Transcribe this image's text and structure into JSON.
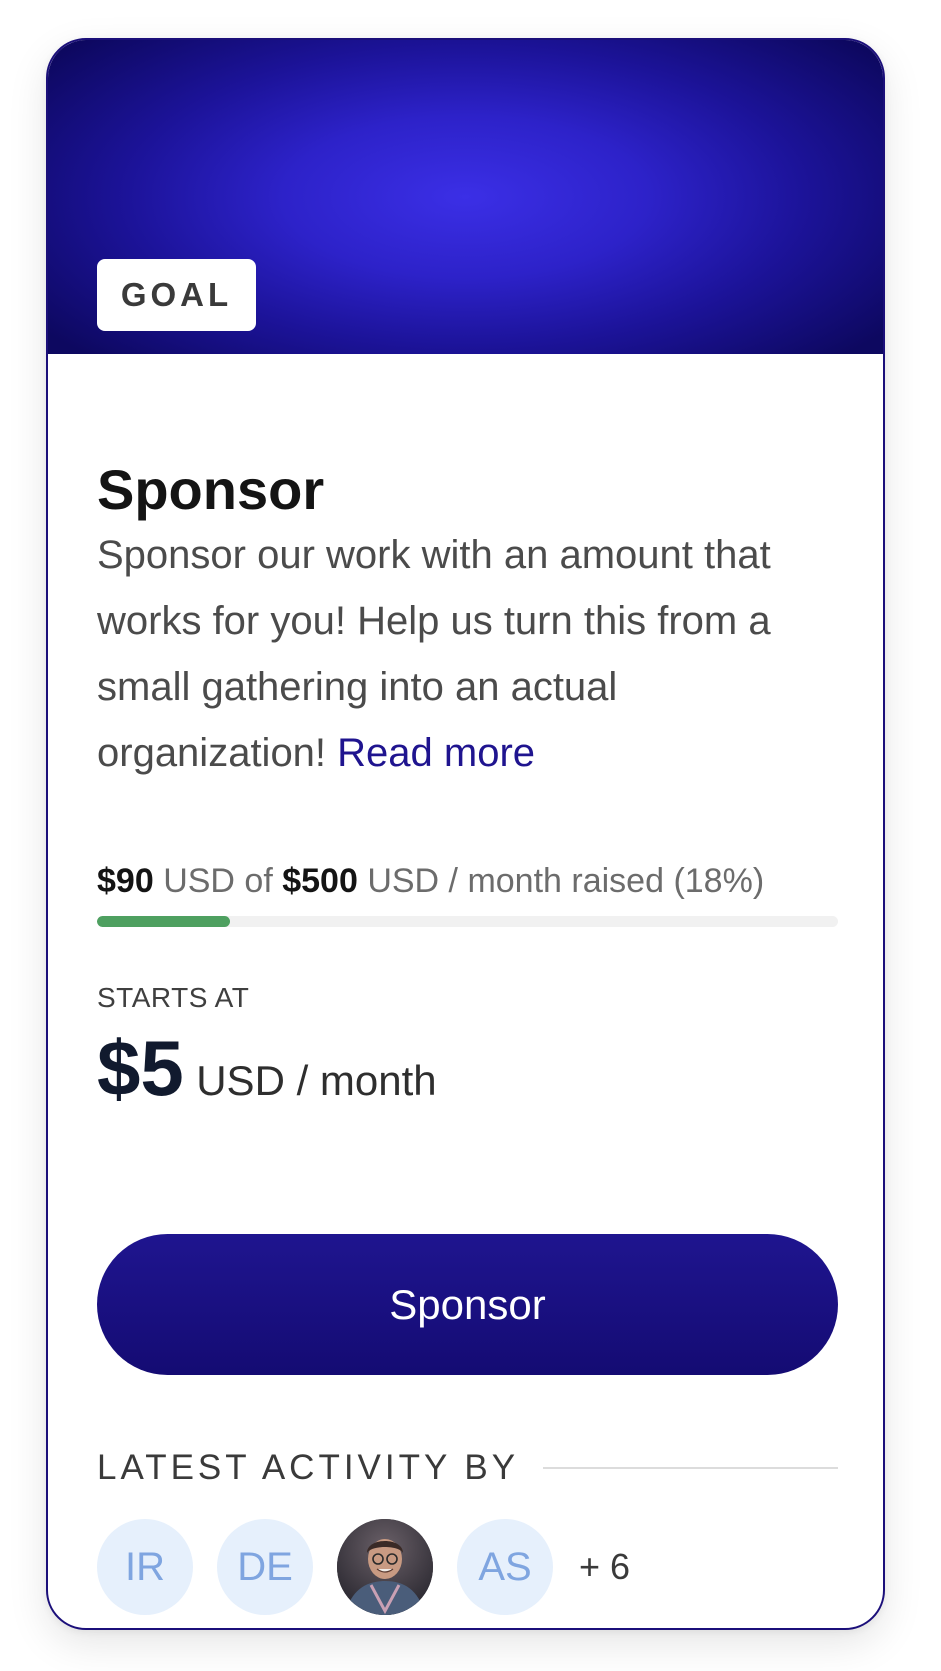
{
  "tier": {
    "badge": "GOAL",
    "title": "Sponsor",
    "description": "Sponsor our work with an amount that works for you! Help us turn this from a small gathering into an actual organization!",
    "read_more": "Read more"
  },
  "goal": {
    "raised_amount": "$90",
    "raised_currency": "USD of",
    "target_amount": "$500",
    "suffix": "USD / month raised (18%)",
    "progress_percent": 18,
    "progress_color": "#4ea060"
  },
  "pricing": {
    "label": "STARTS AT",
    "amount": "$5",
    "unit": "USD / month"
  },
  "cta": {
    "label": "Sponsor",
    "color": "#1a1083"
  },
  "activity": {
    "label": "LATEST ACTIVITY BY",
    "contributors": [
      {
        "initials": "IR"
      },
      {
        "initials": "DE"
      },
      {
        "initials": "",
        "photo": true
      },
      {
        "initials": "AS"
      }
    ],
    "more": "+ 6"
  },
  "colors": {
    "accent": "#1f148f",
    "banner": "#2d22c9",
    "avatar_bg": "#e6f0fc",
    "avatar_text": "#7fa5e0"
  }
}
